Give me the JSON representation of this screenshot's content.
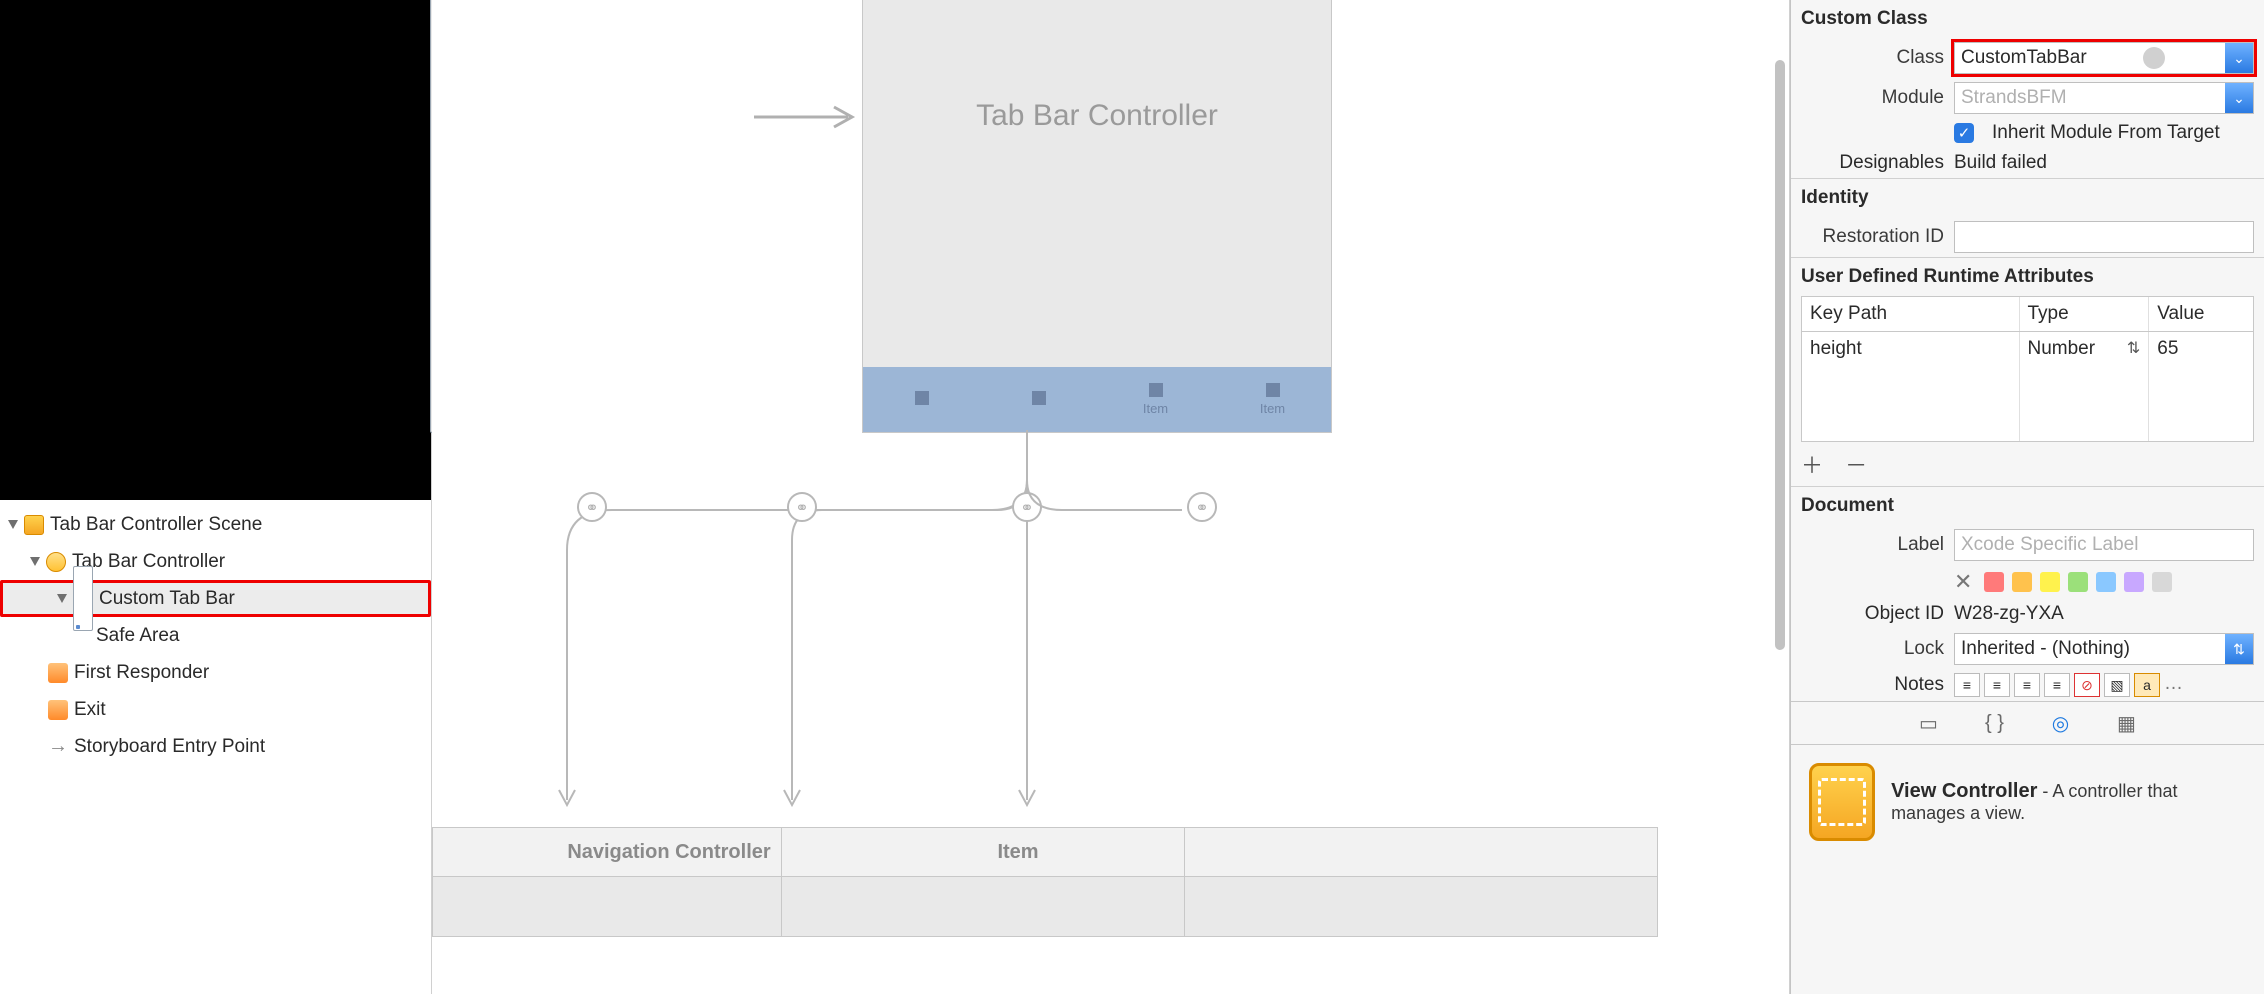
{
  "outline": {
    "scene": "Tab Bar Controller Scene",
    "controller": "Tab Bar Controller",
    "custom_tabbar": "Custom Tab Bar",
    "safe_area": "Safe Area",
    "first_responder": "First Responder",
    "exit": "Exit",
    "entry_point": "Storyboard Entry Point"
  },
  "canvas": {
    "phone_title": "Tab Bar Controller",
    "tab_items": [
      "",
      "",
      "Item",
      "Item"
    ],
    "child1": "Navigation Controller",
    "child2": "Item",
    "child3": ""
  },
  "inspector": {
    "custom_class": {
      "header": "Custom Class",
      "class_label": "Class",
      "class_value": "CustomTabBar",
      "module_label": "Module",
      "module_placeholder": "StrandsBFM",
      "inherit_label": "Inherit Module From Target",
      "designables_label": "Designables",
      "designables_value": "Build failed"
    },
    "identity": {
      "header": "Identity",
      "restoration_label": "Restoration ID"
    },
    "udra": {
      "header": "User Defined Runtime Attributes",
      "col_key": "Key Path",
      "col_type": "Type",
      "col_value": "Value",
      "row_key": "height",
      "row_type": "Number",
      "row_value": "65"
    },
    "document": {
      "header": "Document",
      "label_label": "Label",
      "label_placeholder": "Xcode Specific Label",
      "object_id_label": "Object ID",
      "object_id_value": "W28-zg-YXA",
      "lock_label": "Lock",
      "lock_value": "Inherited - (Nothing)",
      "notes_label": "Notes"
    },
    "library": {
      "item_title": "View Controller",
      "item_desc": " - A controller that manages a view."
    }
  }
}
